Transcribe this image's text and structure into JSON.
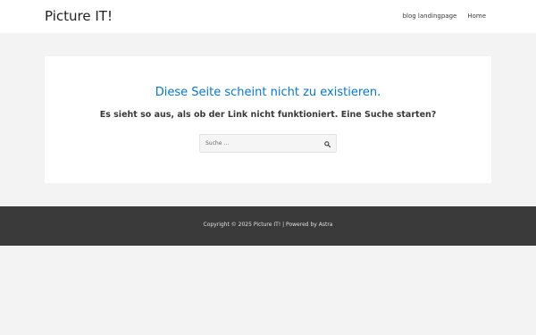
{
  "header": {
    "site_title": "Picture IT!",
    "nav": [
      {
        "label": "blog landingpage"
      },
      {
        "label": "Home"
      }
    ]
  },
  "main": {
    "title": "Diese Seite scheint nicht zu existieren.",
    "subtitle": "Es sieht so aus, als ob der Link nicht funktioniert. Eine Suche starten?",
    "search": {
      "placeholder": "Suche …",
      "value": "",
      "button_icon": "search-icon"
    }
  },
  "footer": {
    "copyright_prefix": "Copyright © 2025 ",
    "site_link": "Picture IT!",
    "separator": " | Powered by ",
    "theme_link": "Astra"
  },
  "colors": {
    "page_background": "#f3f3f3",
    "accent": "#0a77c4",
    "footer_background": "#3a3a3a"
  }
}
